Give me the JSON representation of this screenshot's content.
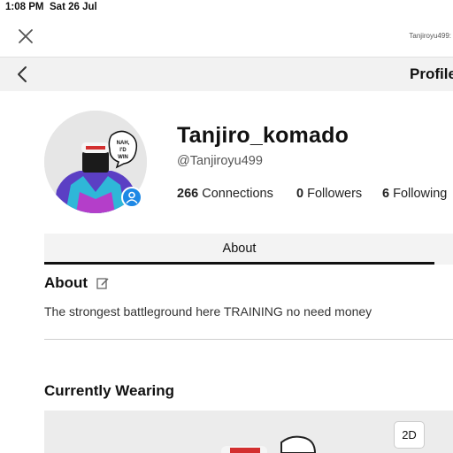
{
  "status_bar": {
    "time": "1:08 PM",
    "date": "Sat 26 Jul"
  },
  "topbar": {
    "url": "Tanjiroyu499:",
    "close_icon": "close-icon"
  },
  "navbar": {
    "back_icon": "chevron-left-icon",
    "title": "Profile"
  },
  "profile": {
    "display_name": "Tanjiro_komado",
    "username": "@Tanjiroyu499",
    "avatar_speech_text": "NAH, I'D WIN",
    "avatar_cap_text": "ROBLOX",
    "presence_badge_color": "#1e88e5",
    "stats": {
      "connections_count": "266",
      "connections_label": "Connections",
      "followers_count": "0",
      "followers_label": "Followers",
      "following_count": "6",
      "following_label": "Following"
    }
  },
  "tabs": [
    {
      "label": "About",
      "active": true
    }
  ],
  "about": {
    "heading": "About",
    "edit_icon": "edit-icon",
    "bio": "The strongest battleground here TRAINING no need money"
  },
  "wearing": {
    "heading": "Currently Wearing",
    "view_toggle": "2D"
  }
}
